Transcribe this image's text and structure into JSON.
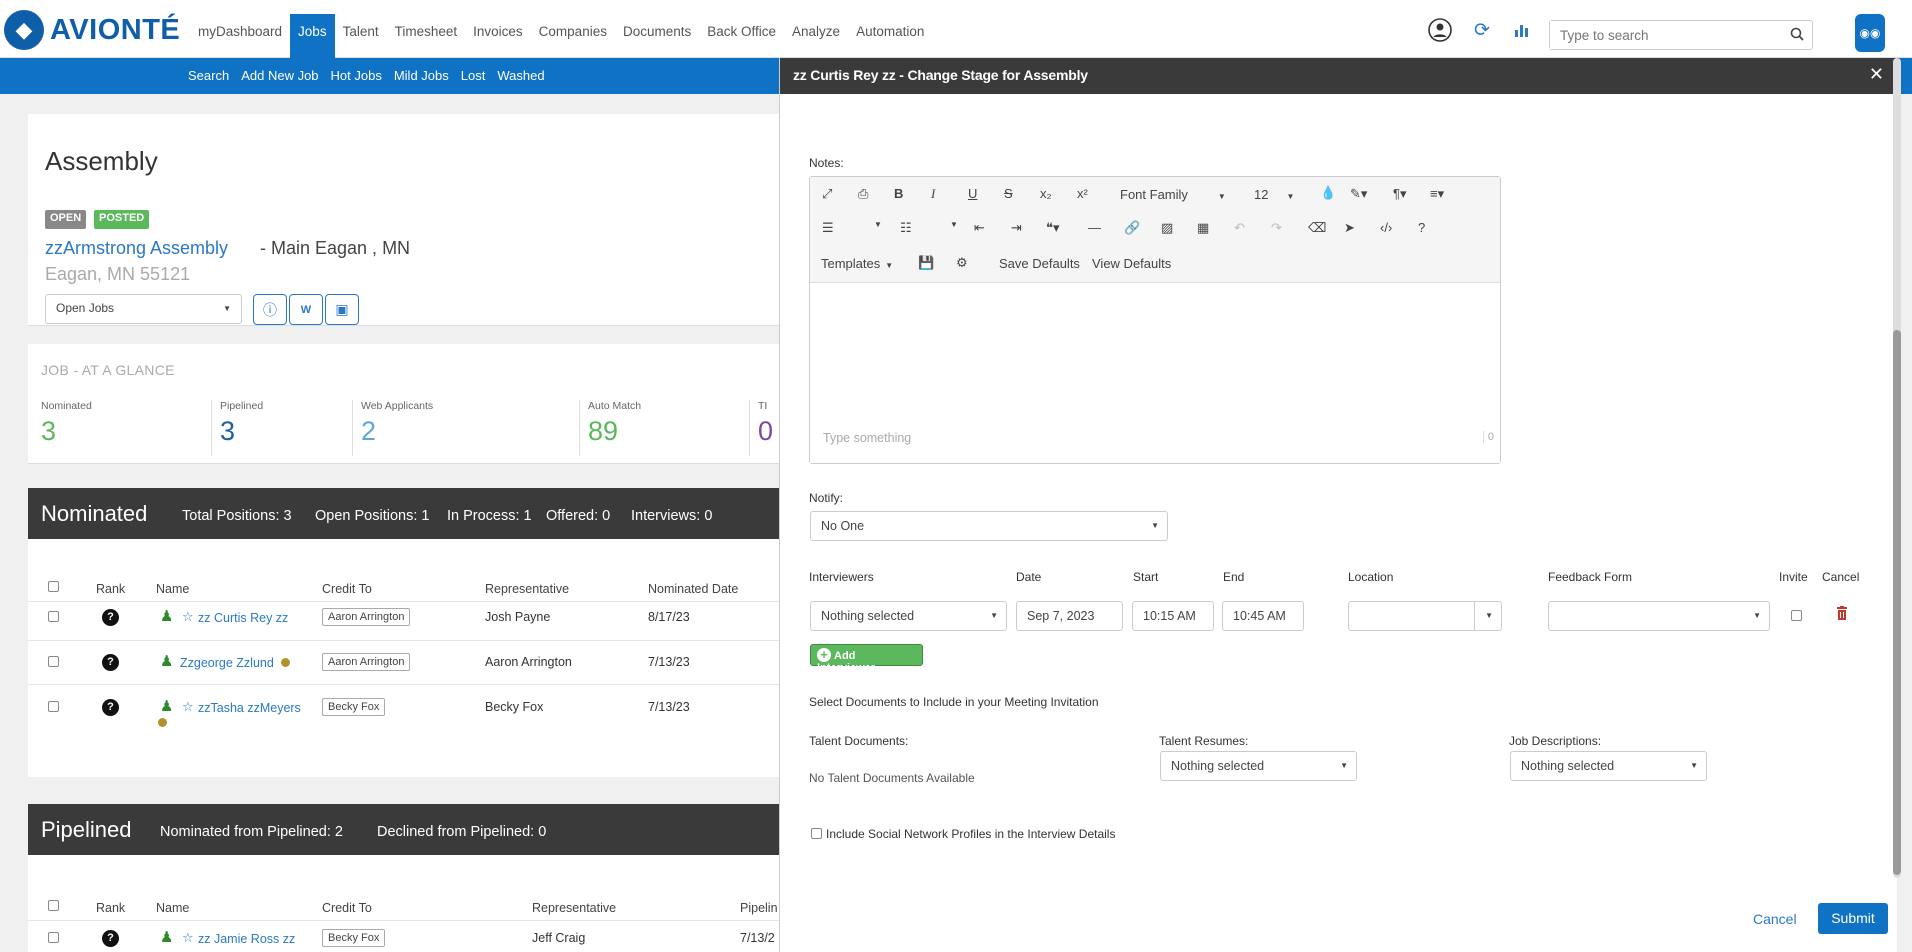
{
  "app": {
    "logo_text": "AVIONTÉ"
  },
  "main_nav": [
    "myDashboard",
    "Jobs",
    "Talent",
    "Timesheet",
    "Invoices",
    "Companies",
    "Documents",
    "Back Office",
    "Analyze",
    "Automation"
  ],
  "active_nav": "Jobs",
  "search": {
    "placeholder": "Type to search"
  },
  "sub_nav": [
    "Search",
    "Add New Job",
    "Hot Jobs",
    "Mild Jobs",
    "Lost",
    "Washed"
  ],
  "job": {
    "title": "Assembly",
    "badges": [
      "OPEN",
      "POSTED"
    ],
    "company": "zzArmstrong Assembly",
    "location": "- Main Eagan , MN",
    "city_zip": "Eagan, MN 55121",
    "jobs_select": "Open Jobs"
  },
  "glance": {
    "header": "JOB - AT A GLANCE",
    "stats": [
      {
        "label": "Nominated",
        "value": "3",
        "color": "#5cb85c"
      },
      {
        "label": "Pipelined",
        "value": "3",
        "color": "#1f5f9e"
      },
      {
        "label": "Web Applicants",
        "value": "2",
        "color": "#5ba7d9"
      },
      {
        "label": "Auto Match",
        "value": "89",
        "color": "#5cb85c"
      },
      {
        "label": "TI",
        "value": "0",
        "color": "#7b4aa0"
      }
    ]
  },
  "nominated": {
    "title": "Nominated",
    "summary": [
      "Total Positions: 3",
      "Open Positions: 1",
      "In Process: 1",
      "Offered: 0",
      "Interviews: 0"
    ],
    "columns": [
      "Rank",
      "Name",
      "Credit To",
      "Representative",
      "Nominated Date"
    ],
    "rows": [
      {
        "name": "zz Curtis Rey zz",
        "credit": "Aaron Arrington",
        "rep": "Josh Payne",
        "date": "8/17/23"
      },
      {
        "name": "Zzgeorge Zzlund",
        "credit": "Aaron Arrington",
        "rep": "Aaron Arrington",
        "date": "7/13/23"
      },
      {
        "name": "zzTasha zzMeyers",
        "credit": "Becky Fox",
        "rep": "Becky Fox",
        "date": "7/13/23"
      }
    ]
  },
  "pipelined": {
    "title": "Pipelined",
    "summary": [
      "Nominated from Pipelined: 2",
      "Declined from Pipelined: 0"
    ],
    "columns": [
      "Rank",
      "Name",
      "Credit To",
      "Representative",
      "Pipelin"
    ],
    "rows": [
      {
        "name": "zz Jamie Ross zz",
        "credit": "Becky Fox",
        "rep": "Jeff Craig",
        "date": "7/13/2"
      }
    ]
  },
  "modal": {
    "title": "zz Curtis Rey zz - Change Stage for Assembly",
    "notes_label": "Notes:",
    "editor": {
      "font_family": "Font Family",
      "font_size": "12",
      "templates": "Templates",
      "save_defaults": "Save Defaults",
      "view_defaults": "View Defaults",
      "placeholder": "Type something",
      "char_count": "0"
    },
    "notify_label": "Notify:",
    "notify_value": "No One",
    "interviewers": {
      "headers": [
        "Interviewers",
        "Date",
        "Start",
        "End",
        "Location",
        "Feedback Form",
        "Invite",
        "Cancel"
      ],
      "interviewer_value": "Nothing selected",
      "date": "Sep 7, 2023",
      "start": "10:15 AM",
      "end": "10:45 AM",
      "add_label": "Add Interviewer"
    },
    "documents": {
      "heading": "Select Documents to Include in your Meeting Invitation",
      "talent_docs_label": "Talent Documents:",
      "talent_docs_value": "No Talent Documents Available",
      "resumes_label": "Talent Resumes:",
      "resumes_value": "Nothing selected",
      "job_desc_label": "Job Descriptions:",
      "job_desc_value": "Nothing selected"
    },
    "social_label": "Include Social Network Profiles in the Interview Details",
    "cancel_label": "Cancel",
    "submit_label": "Submit"
  }
}
